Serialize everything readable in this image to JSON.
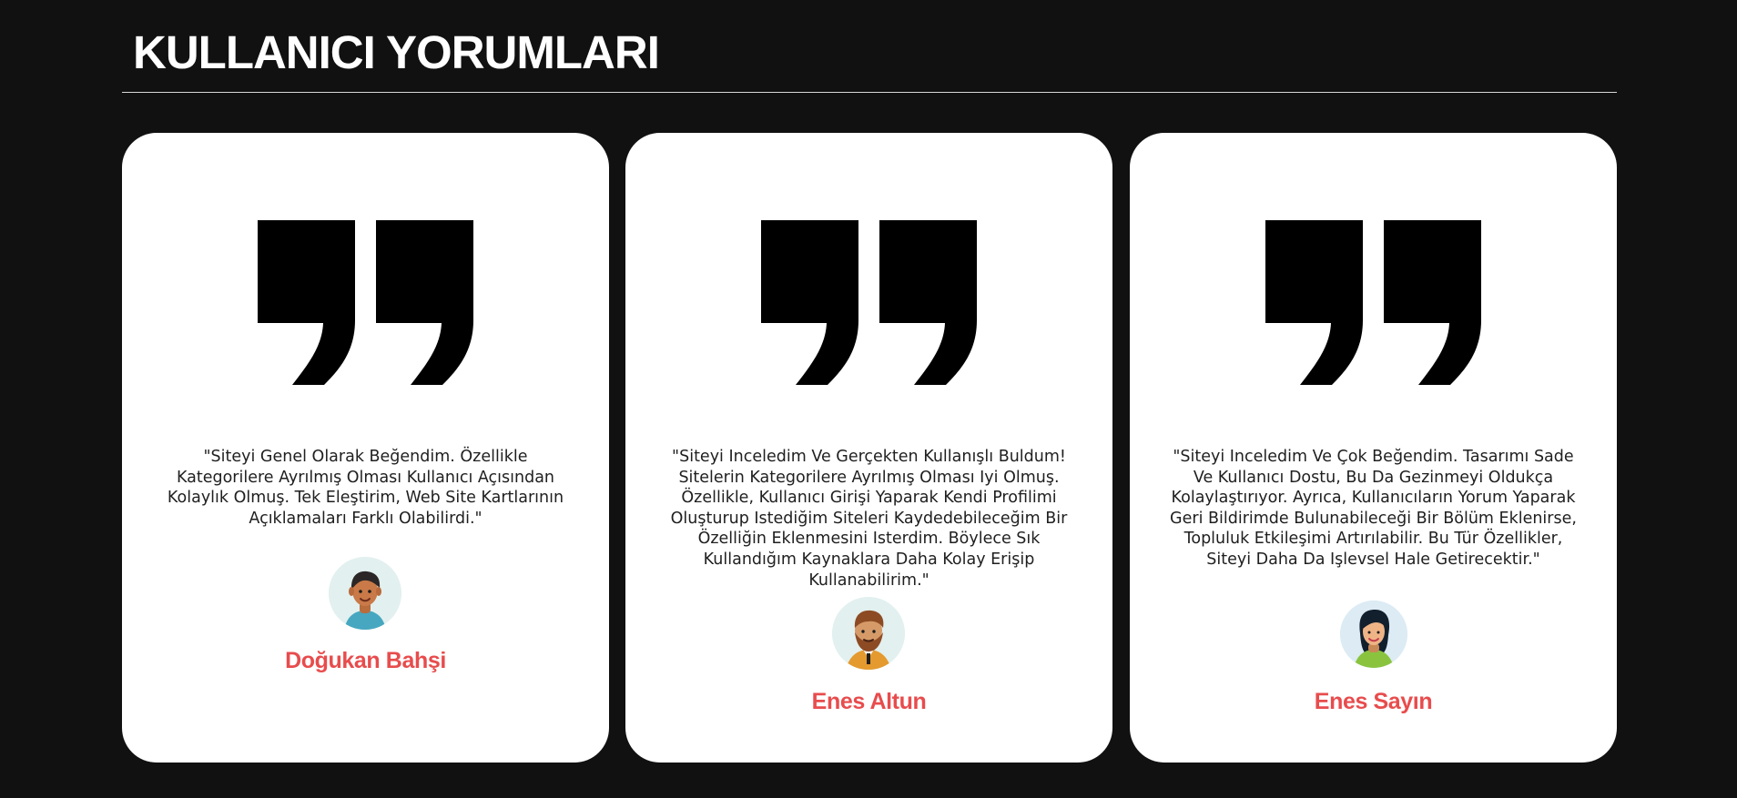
{
  "page": {
    "title": "KULLANICI YORUMLARI"
  },
  "colors": {
    "background": "#111111",
    "card": "#ffffff",
    "name_accent": "#e84c4d",
    "title": "#ffffff"
  },
  "testimonials": [
    {
      "quote_icon": "double-quote-icon",
      "comment": "\"Siteyi Genel Olarak Beğendim. Özellikle Kategorilere Ayrılmış Olması Kullanıcı Açısından Kolaylık Olmuş. Tek Eleştirim, Web Site Kartlarının Açıklamaları Farklı Olabilirdi.\"",
      "avatar_icon": "man-avatar-icon",
      "name": "Doğukan Bahşi"
    },
    {
      "quote_icon": "double-quote-icon",
      "comment": "\"Siteyi Inceledim Ve Gerçekten Kullanışlı Buldum! Sitelerin Kategorilere Ayrılmış Olması Iyi Olmuş. Özellikle, Kullanıcı Girişi Yaparak Kendi Profilimi Oluşturup Istediğim Siteleri Kaydedebileceğim Bir Özelliğin Eklenmesini Isterdim. Böylece Sık Kullandığım Kaynaklara Daha Kolay Erişip Kullanabilirim.\"",
      "avatar_icon": "bearded-man-avatar-icon",
      "name": "Enes Altun"
    },
    {
      "quote_icon": "double-quote-icon",
      "comment": "\"Siteyi Inceledim Ve Çok Beğendim. Tasarımı Sade Ve Kullanıcı Dostu, Bu Da Gezinmeyi Oldukça Kolaylaştırıyor. Ayrıca, Kullanıcıların Yorum Yaparak Geri Bildirimde Bulunabileceği Bir Bölüm Eklenirse, Topluluk Etkileşimi Artırılabilir. Bu Tür Özellikler, Siteyi Daha Da Işlevsel Hale Getirecektir.\"",
      "avatar_icon": "woman-avatar-icon",
      "name": "Enes Sayın"
    }
  ]
}
